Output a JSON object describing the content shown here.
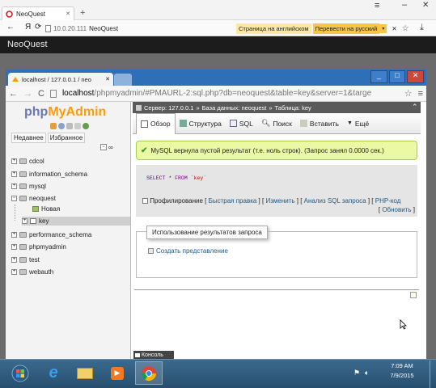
{
  "outer_browser": {
    "tab_title": "NeoQuest",
    "back_label": "←",
    "yandex_label": "Я",
    "url_host": "10.0.20.111",
    "url_title": "NeoQuest",
    "translate_info": "Страница на английском",
    "translate_button": "Перевести на русский",
    "menu_glyph": "≡",
    "minimize_glyph": "–",
    "close_glyph": "✕",
    "new_tab_glyph": "+"
  },
  "app_bar": {
    "title": "NeoQuest"
  },
  "inner_browser": {
    "tab_title": "localhost / 127.0.0.1 / neo",
    "url_host": "localhost",
    "url_path": "/phpmyadmin/#PMAURL-2:sql.php?db=neoquest&table=key&server=1&targe",
    "back_glyph": "←",
    "forward_glyph": "→",
    "reload_glyph": "C",
    "star_glyph": "☆",
    "menu_glyph": "≡",
    "win_min": "_",
    "win_max": "□",
    "win_close": "✕"
  },
  "pma": {
    "logo_php": "php",
    "logo_myadmin": "MyAdmin",
    "left_tabs": [
      "Недавнее",
      "Избранное"
    ],
    "databases": [
      {
        "name": "cdcol",
        "expanded": false
      },
      {
        "name": "information_schema",
        "expanded": false
      },
      {
        "name": "mysql",
        "expanded": false
      },
      {
        "name": "neoquest",
        "expanded": true
      },
      {
        "name": "performance_schema",
        "expanded": false
      },
      {
        "name": "phpmyadmin",
        "expanded": false
      },
      {
        "name": "test",
        "expanded": false
      },
      {
        "name": "webauth",
        "expanded": false
      }
    ],
    "neoquest_children": [
      "Новая",
      "key"
    ],
    "breadcrumb": {
      "server": "Сервер: 127.0.0.1",
      "database": "База данных: neoquest",
      "table": "Таблица: key"
    },
    "menu": [
      "Обзор",
      "Структура",
      "SQL",
      "Поиск",
      "Вставить",
      "Ещё"
    ],
    "success_message": "MySQL вернула пустой результат (т.е. ноль строк). (Запрос занял 0.0000 сек.)",
    "sql": {
      "keyword1": "SELECT",
      "star": "*",
      "keyword2": "FROM",
      "table": "`key`"
    },
    "profiling": {
      "label": "Профилирование",
      "links": [
        "Быстрая правка",
        "Изменить",
        "Анализ SQL запроса",
        "PHP-код",
        "Обновить"
      ]
    },
    "query_results_legend": "Использование результатов запроса",
    "create_view": "Создать представление",
    "console": "Консоль"
  },
  "taskbar": {
    "time": "7:09 AM",
    "date": "7/9/2015"
  },
  "colors": {
    "inner_tabbar": "#2e6fb7",
    "pma_orange": "#f89c0e",
    "pma_blue": "#6c78af",
    "success_bg": "#ebf8a4",
    "link": "#235a81"
  }
}
